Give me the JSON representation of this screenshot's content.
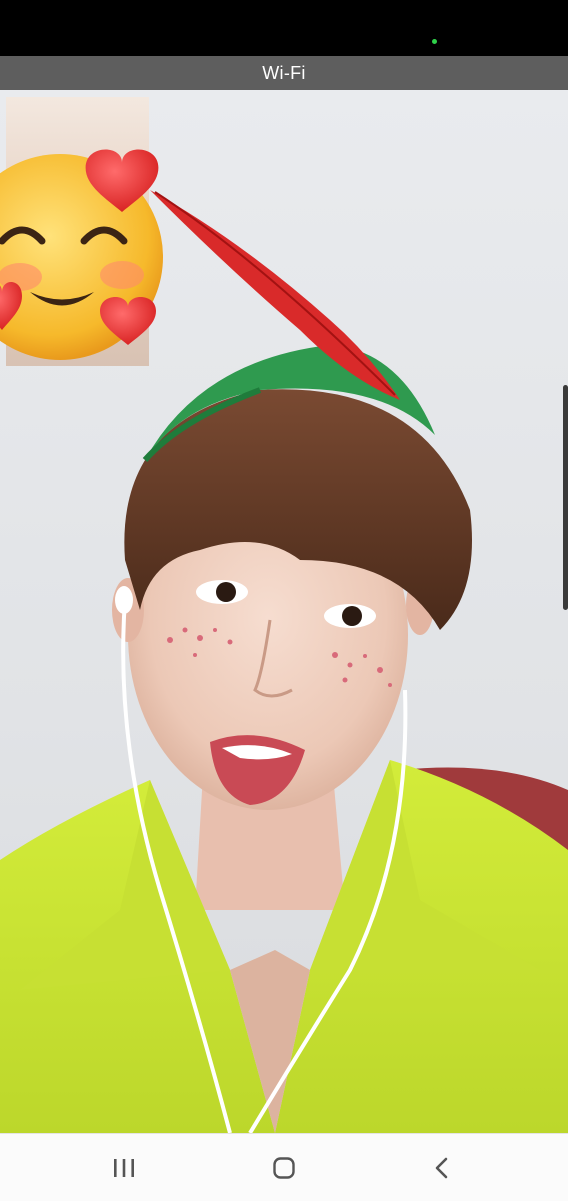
{
  "status_bar": {
    "banner": "Wi-Fi"
  },
  "call": {
    "remote_video": "remote-participant-video",
    "self_view": "local-camera-preview",
    "sticker": "smiling-face-with-hearts-icon"
  },
  "nav": {
    "recents": "recent-apps-icon",
    "home": "home-icon",
    "back": "back-icon"
  },
  "colors": {
    "banner_bg": "#5e5e5e",
    "nav_bg": "#fbfbfb",
    "camera_indicator": "#2fd24a"
  }
}
